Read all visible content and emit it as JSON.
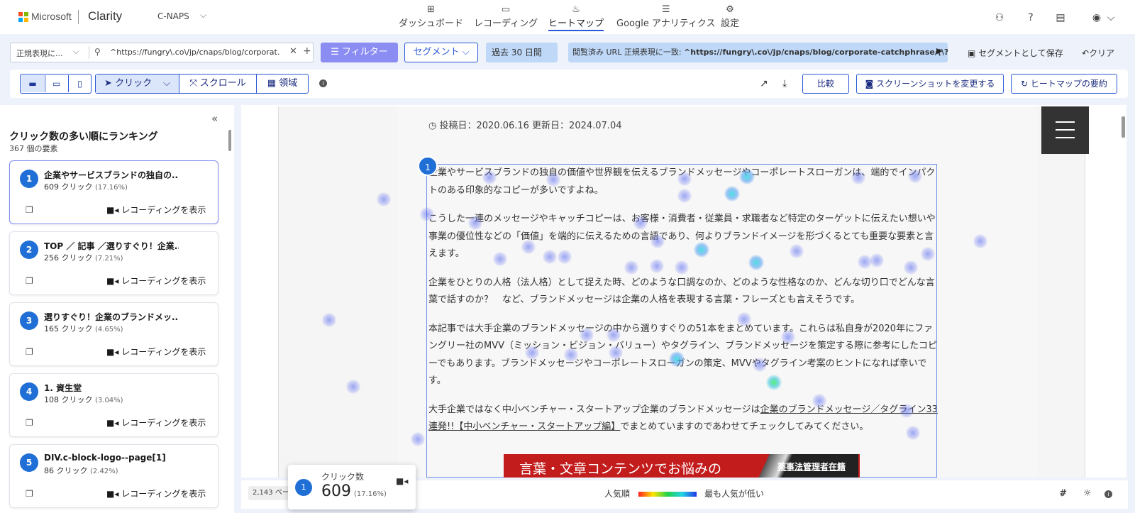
{
  "nav": {
    "brand": "Microsoft",
    "app": "Clarity",
    "project": "C-NAPS",
    "tabs": [
      {
        "label": "ダッシュボード"
      },
      {
        "label": "レコーディング"
      },
      {
        "label": "ヒートマップ"
      },
      {
        "label": "Google アナリティクス"
      },
      {
        "label": "設定"
      }
    ]
  },
  "filters": {
    "regex_mode": "正規表現に...",
    "url_value": "^https://fungry\\.co\\/jp/cnaps/blog/corporat...",
    "filter_label": "フィルター",
    "segment_label": "セグメント",
    "date_chip": "過去 30 日間",
    "url_chip_prefix": "閲覧済み URL 正規表現に一致: ",
    "url_chip_value": "^https://fungry\\.co\\/jp/cnaps/blog/corporate-catchphrase/(\\?.*)?$",
    "save_segment": "セグメントとして保存",
    "clear": "クリア"
  },
  "toolbar": {
    "modes": [
      {
        "label": "クリック"
      },
      {
        "label": "スクロール"
      },
      {
        "label": "領域"
      }
    ],
    "compare": "比較",
    "change_screenshot": "スクリーンショットを変更する",
    "summary": "ヒートマップの要約"
  },
  "ranking": {
    "title": "クリック数の多い順にランキング",
    "subtitle": "367 個の要素",
    "view_recording": "レコーディングを表示",
    "items": [
      {
        "rank": "1",
        "title": "企業やサービスブランドの独自の...",
        "clicks": "609 クリック",
        "pct": "(17.16%)"
      },
      {
        "rank": "2",
        "title": "TOP ／ 記事 ／選りすぐり！企業...",
        "clicks": "256 クリック",
        "pct": "(7.21%)"
      },
      {
        "rank": "3",
        "title": "選りすぐり！企業のブランドメッ...",
        "clicks": "165 クリック",
        "pct": "(4.65%)"
      },
      {
        "rank": "4",
        "title": "1. 資生堂",
        "clicks": "108 クリック",
        "pct": "(3.04%)"
      },
      {
        "rank": "5",
        "title": "DIV.c-block-logo--page[1]",
        "clicks": "86 クリック",
        "pct": "(2.42%)"
      }
    ]
  },
  "page": {
    "dates": "投稿日：2020.06.16  更新日：2024.07.04",
    "badge": "1",
    "p1": "企業やサービスブランドの独自の価値や世界観を伝えるブランドメッセージやコーポレートスローガンは、端的でインパクトのある印象的なコピーが多いですよね。",
    "p2": "こうした一連のメッセージやキャッチコピーは、お客様・消費者・従業員・求職者など特定のターゲットに伝えたい想いや事業の優位性などの「価値」を端的に伝えるための言語であり、何よりブランドイメージを形づくるとても重要な要素と言えます。",
    "p3": "企業をひとりの人格（法人格）として捉えた時、どのような口調なのか、どのような性格なのか、どんな切り口でどんな言葉で話すのか？　など、ブランドメッセージは企業の人格を表現する言葉・フレーズとも言えそうです。",
    "p4": "本記事では大手企業のブランドメッセージの中から選りすぐりの51本をまとめています。これらは私自身が2020年にファングリー社のMVV（ミッション・ビジョン・バリュー）やタグライン、ブランドメッセージを策定する際に参考にしたコピーでもあります。ブランドメッセージやコーポレートスローガンの策定、MVVやタグライン考案のヒントになれば幸いです。",
    "p5_pre": "大手企業ではなく中小ベンチャー・スタートアップ企業のブランドメッセージは",
    "p5_link": "企業のブランドメッセージ／タグライン33連発!!【中小ベンチャー・スタートアップ編】",
    "p5_post": "でまとめていますのであわせてチェックしてみてください。",
    "banner_text": "言葉・文章コンテンツでお悩みの",
    "banner_sub": "薬事法管理者在籍"
  },
  "bottom": {
    "pages": "2,143 ペー",
    "legend_left": "人気順",
    "legend_right": "最も人気が低い"
  },
  "tooltip": {
    "rank": "1",
    "label": "クリック数",
    "value": "609",
    "pct": "(17.16%)"
  },
  "colors": {
    "accent": "#2b58d6",
    "filter_button": "#8b8df2",
    "badge": "#1f6fd6",
    "chip": "#bfd8f7"
  },
  "icons": [
    "dashboard-icon",
    "recording-icon",
    "heatmap-icon",
    "analytics-icon",
    "settings-icon",
    "search-icon",
    "close-icon",
    "camera-icon",
    "share-icon",
    "download-icon",
    "copy-icon",
    "hamburger-icon"
  ]
}
